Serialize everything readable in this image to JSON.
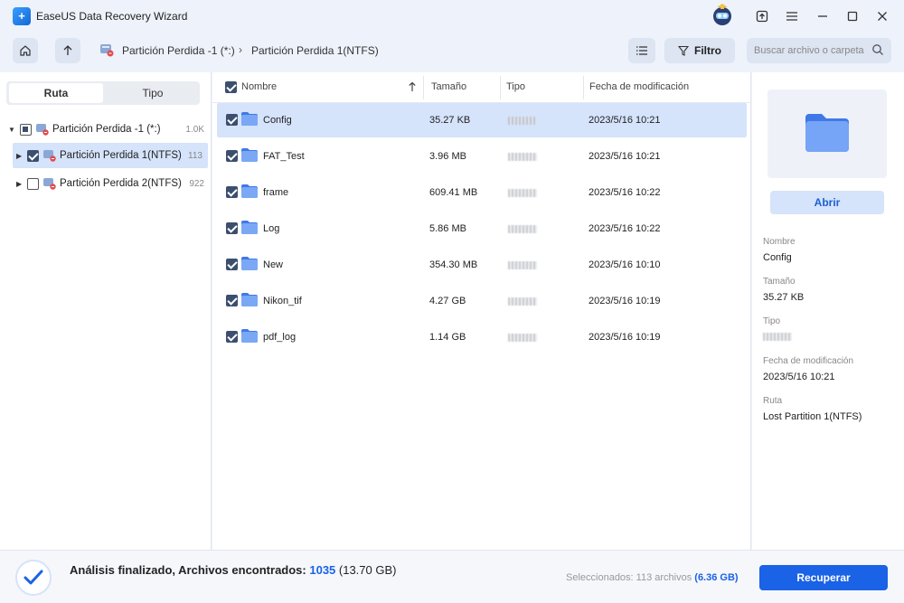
{
  "window": {
    "title": "EaseUS Data Recovery Wizard",
    "logo_icon": "easeus-logo-icon"
  },
  "nav": {
    "breadcrumb": [
      "Partición Perdida -1 (*:)",
      "Partición Perdida 1(NTFS)"
    ],
    "view_toggle_icon": "list-view-icon",
    "filter_label": "Filtro",
    "search_placeholder": "Buscar archivo o carpeta"
  },
  "sidebar": {
    "tabs": [
      {
        "label": "Ruta",
        "active": true
      },
      {
        "label": "Tipo",
        "active": false
      }
    ],
    "tree": [
      {
        "label": "Partición Perdida -1 (*:)",
        "count": "1.0K",
        "state": "partial",
        "expanded": true
      },
      {
        "label": "Partición Perdida 1(NTFS)",
        "count": "113",
        "state": "checked",
        "selected": true
      },
      {
        "label": "Partición Perdida 2(NTFS)",
        "count": "922",
        "state": "unchecked"
      }
    ]
  },
  "table": {
    "columns": [
      "Nombre",
      "Tamaño",
      "Tipo",
      "Fecha de modificación"
    ],
    "rows": [
      {
        "name": "Config",
        "size": "35.27 KB",
        "date": "2023/5/16 10:21",
        "selected": true
      },
      {
        "name": "FAT_Test",
        "size": "3.96 MB",
        "date": "2023/5/16 10:21"
      },
      {
        "name": "frame",
        "size": "609.41 MB",
        "date": "2023/5/16 10:22"
      },
      {
        "name": "Log",
        "size": "5.86 MB",
        "date": "2023/5/16 10:22"
      },
      {
        "name": "New",
        "size": "354.30 MB",
        "date": "2023/5/16 10:10"
      },
      {
        "name": "Nikon_tif",
        "size": "4.27 GB",
        "date": "2023/5/16 10:19"
      },
      {
        "name": "pdf_log",
        "size": "1.14 GB",
        "date": "2023/5/16 10:19"
      }
    ]
  },
  "details": {
    "open_label": "Abrir",
    "name_label": "Nombre",
    "name_value": "Config",
    "size_label": "Tamaño",
    "size_value": "35.27 KB",
    "type_label": "Tipo",
    "date_label": "Fecha de modificación",
    "date_value": "2023/5/16 10:21",
    "path_label": "Ruta",
    "path_value": "Lost Partition 1(NTFS)"
  },
  "footer": {
    "status_prefix": "Análisis finalizado, Archivos encontrados: ",
    "found_count": "1035",
    "found_size": " (13.70 GB)",
    "selected_prefix": "Seleccionados: 113 archivos ",
    "selected_size": "(6.36 GB)",
    "recover_label": "Recuperar"
  },
  "colors": {
    "accent": "#1a62e6",
    "selection": "#d5e3fb",
    "folder": "#5a8ff0"
  }
}
